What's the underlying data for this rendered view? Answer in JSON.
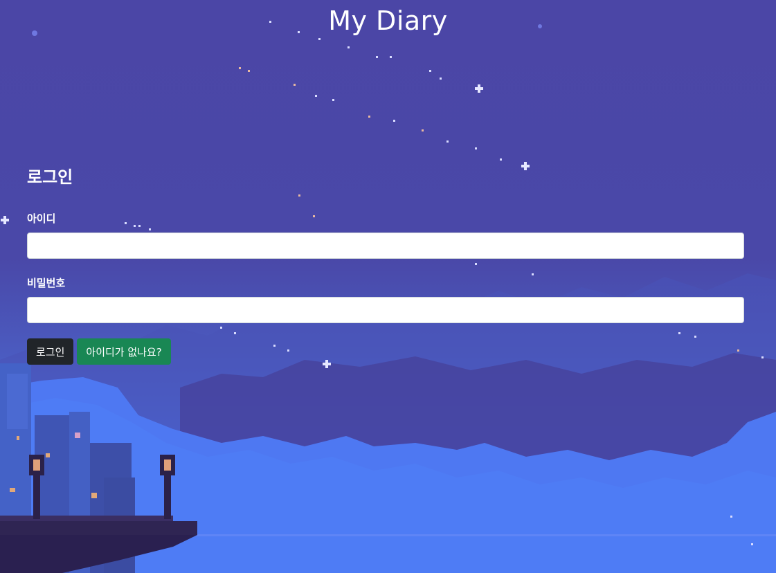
{
  "app": {
    "title": "My Diary"
  },
  "login": {
    "heading": "로그인",
    "id_label": "아이디",
    "id_value": "",
    "password_label": "비밀번호",
    "password_value": "",
    "login_button": "로그인",
    "signup_button": "아이디가 없나요?"
  },
  "colors": {
    "login_button_bg": "#212529",
    "signup_button_bg": "#198754",
    "sky": "#4a48a8",
    "clouds": "#4e78f2"
  }
}
